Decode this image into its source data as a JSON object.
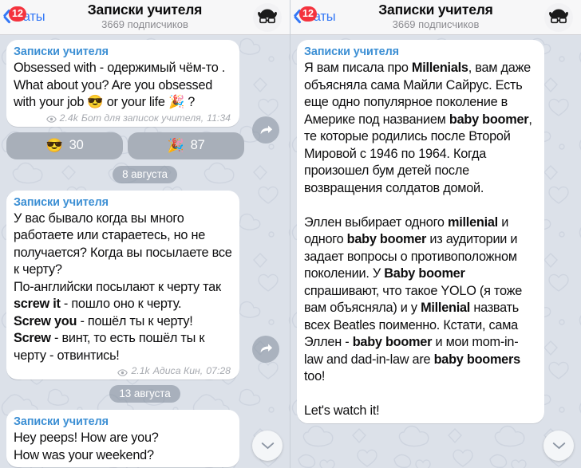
{
  "header": {
    "back_label": "Чаты",
    "back_badge": "12",
    "title": "Записки учителя",
    "subtitle": "3669 подписчиков",
    "avatar_icon": "teacher-hat-glasses-icon",
    "accent_color": "#3478f6",
    "badge_color": "#f4333e",
    "bg_color": "#f7f7f8"
  },
  "chat": {
    "background_color": "#dce1e9",
    "bubble_color": "#ffffff",
    "channel_name_color": "#3c8fd4",
    "scroll_down_icon": "chevron-down-icon",
    "share_icon": "share-arrow-icon"
  },
  "left_panel": {
    "messages": [
      {
        "channel": "Записки учителя",
        "lines": [
          {
            "text": "Obsessed with - одержимый чём-то ."
          },
          {
            "text": "What about you? Are you obsessed with your job 😎 or your life 🎉 ?"
          }
        ],
        "views": "2.4k",
        "author": "Бот для записок учителя,",
        "time": "11:34"
      },
      {
        "channel": "Записки учителя",
        "lines": [
          {
            "text": "У вас бывало когда вы много работаете или стараетесь, но не получается? Когда вы посылаете все к черту?"
          },
          {
            "text": "По-английски посылают к черту так "
          },
          {
            "text": "Screw you"
          },
          {
            "text": "Screw"
          }
        ],
        "views": "2.1k",
        "author": "Адиса Кин,",
        "time": "07:28"
      },
      {
        "channel": "Записки учителя",
        "lines": [
          {
            "text": "Hey peeps! How are you?"
          },
          {
            "text": "How was your weekend?"
          }
        ]
      }
    ],
    "reactions": [
      {
        "emoji": "😎",
        "count": "30"
      },
      {
        "emoji": "🎉",
        "count": "87"
      }
    ],
    "dividers": [
      "8 августа",
      "13 августа"
    ]
  },
  "right_panel": {
    "message": {
      "channel": "Записки учителя",
      "paragraph_1_a": "Я вам писала про ",
      "paragraph_1_b": "Millenials",
      "paragraph_1_c": ", вам даже объясняла сама Майли Сайрус. Есть еще одно популярное поколение в Америке под названием ",
      "paragraph_1_d": "baby boomer",
      "paragraph_1_e": ", те которые родились после Второй Мировой с 1946 по 1964. Когда произошел бум детей после возвращения солдатов домой.",
      "paragraph_2_a": "Эллен выбирает одного ",
      "paragraph_2_b": "millenial",
      "paragraph_2_c": " и одного ",
      "paragraph_2_d": "baby boomer",
      "paragraph_2_e": " из аудитории и задает вопросы о противоположном поколении. У ",
      "paragraph_2_f": "Baby boomer",
      "paragraph_2_g": " спрашивают, что такое YOLO (я тоже вам объясняла) и у ",
      "paragraph_2_h": "Millenial",
      "paragraph_2_i": " назвать всех Beatles поименно. Кстати, сама Эллен - ",
      "paragraph_2_j": "baby boomer",
      "paragraph_2_k": " и мои mom-in-law and dad-in-law are ",
      "paragraph_2_l": "baby boomers",
      "paragraph_2_m": " too!",
      "paragraph_3": "Let's watch it!"
    }
  }
}
